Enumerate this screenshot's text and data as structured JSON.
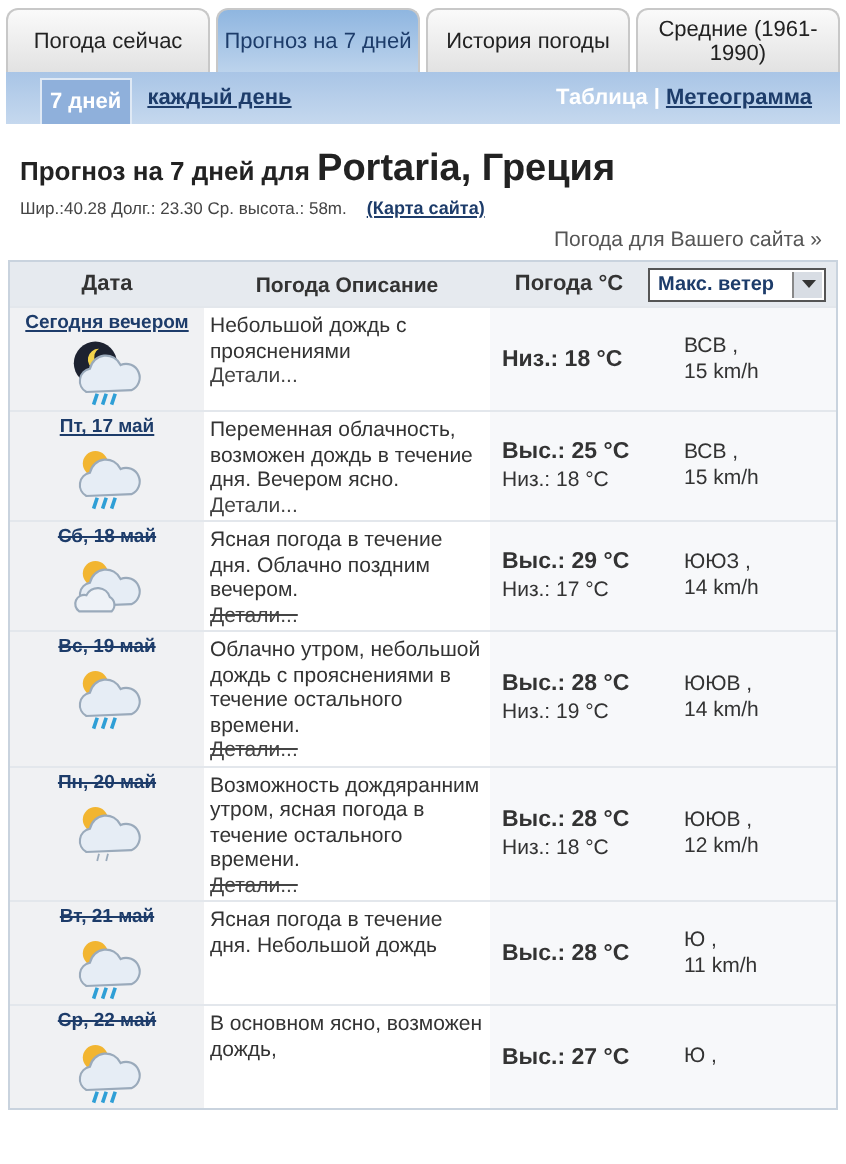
{
  "tabs": [
    {
      "label": "Погода сейчас",
      "selected": false
    },
    {
      "label": "Прогноз на 7 дней",
      "selected": true
    },
    {
      "label": "История погоды",
      "selected": false
    },
    {
      "label": "Средние (1961-1990)",
      "selected": false
    }
  ],
  "periods": [
    {
      "label": "7 дней",
      "selected": true
    },
    {
      "label": "каждый день",
      "selected": false
    }
  ],
  "views": [
    {
      "label": "Таблица",
      "selected": true
    },
    {
      "label": "Метеограмма",
      "selected": false
    }
  ],
  "view_separator": "|",
  "heading": {
    "prefix": "Прогноз на 7 дней для",
    "place": "Portaria, Греция"
  },
  "coords": "Шир.:40.28 Долг.: 23.30 Ср. высота.: 58m.",
  "map_link": "(Карта сайта)",
  "site_link": "Погода для Вашего сайта »",
  "table": {
    "columns": [
      "Дата",
      "Погода Описание",
      "Погода °C"
    ],
    "wind_select": "Макс. ветер",
    "rows": [
      {
        "date": "Сегодня вечером",
        "date_struck": false,
        "kind": "moon_cloud_rain",
        "desc": "Небольшой дождь с прояснениями",
        "details": "Детали...",
        "details_struck": false,
        "temps": [
          {
            "text": "Низ.: 18 °C",
            "bold": true
          }
        ],
        "wind_dir": "ВСВ ,",
        "wind_speed": "15 km/h"
      },
      {
        "date": "Пт, 17 май",
        "date_struck": false,
        "kind": "sun_cloud_rain",
        "desc": "Переменная облачность, возможен дождь в течение дня. Вечером ясно.",
        "details": "Детали...",
        "details_struck": false,
        "temps": [
          {
            "text": "Выс.: 25 °C",
            "bold": true
          },
          {
            "text": "Низ.: 18 °C",
            "bold": false
          }
        ],
        "wind_dir": "ВСВ ,",
        "wind_speed": "15 km/h"
      },
      {
        "date": "Сб, 18 май",
        "date_struck": true,
        "kind": "sun_clouds",
        "desc": "Ясная погода в течение дня. Облачно поздним вечером.",
        "details": "Детали...",
        "details_struck": true,
        "temps": [
          {
            "text": "Выс.: 29 °C",
            "bold": true
          },
          {
            "text": "Низ.: 17 °C",
            "bold": false
          }
        ],
        "wind_dir": "ЮЮЗ ,",
        "wind_speed": "14 km/h"
      },
      {
        "date": "Вс, 19 май",
        "date_struck": true,
        "kind": "sun_cloud_rain",
        "desc": "Облачно утром, небольшой дождь с прояснениями в течение остального времени.",
        "details": "Детали...",
        "details_struck": true,
        "temps": [
          {
            "text": "Выс.: 28 °C",
            "bold": true
          },
          {
            "text": "Низ.: 19 °C",
            "bold": false
          }
        ],
        "wind_dir": "ЮЮВ ,",
        "wind_speed": "14 km/h"
      },
      {
        "date": "Пн, 20 май",
        "date_struck": true,
        "kind": "sun_cloud_drizzle",
        "desc": "Возможность дождяранним утром, ясная погода в течение остального времени.",
        "details": "Детали...",
        "details_struck": true,
        "temps": [
          {
            "text": "Выс.: 28 °C",
            "bold": true
          },
          {
            "text": "Низ.: 18 °C",
            "bold": false
          }
        ],
        "wind_dir": "ЮЮВ ,",
        "wind_speed": "12 km/h"
      },
      {
        "date": "Вт, 21 май",
        "date_struck": true,
        "kind": "sun_cloud_rain",
        "desc": "Ясная погода в течение дня. Небольшой дождь",
        "temps": [
          {
            "text": "Выс.: 28 °C",
            "bold": true
          }
        ],
        "wind_dir": "Ю ,",
        "wind_speed": "11 km/h"
      },
      {
        "date": "Ср, 22 май",
        "date_struck": true,
        "kind": "sun_cloud_rain",
        "desc": "В основном ясно, возможен дождь,",
        "temps": [
          {
            "text": "Выс.: 27 °C",
            "bold": true
          }
        ],
        "wind_dir": "Ю ,"
      }
    ]
  }
}
